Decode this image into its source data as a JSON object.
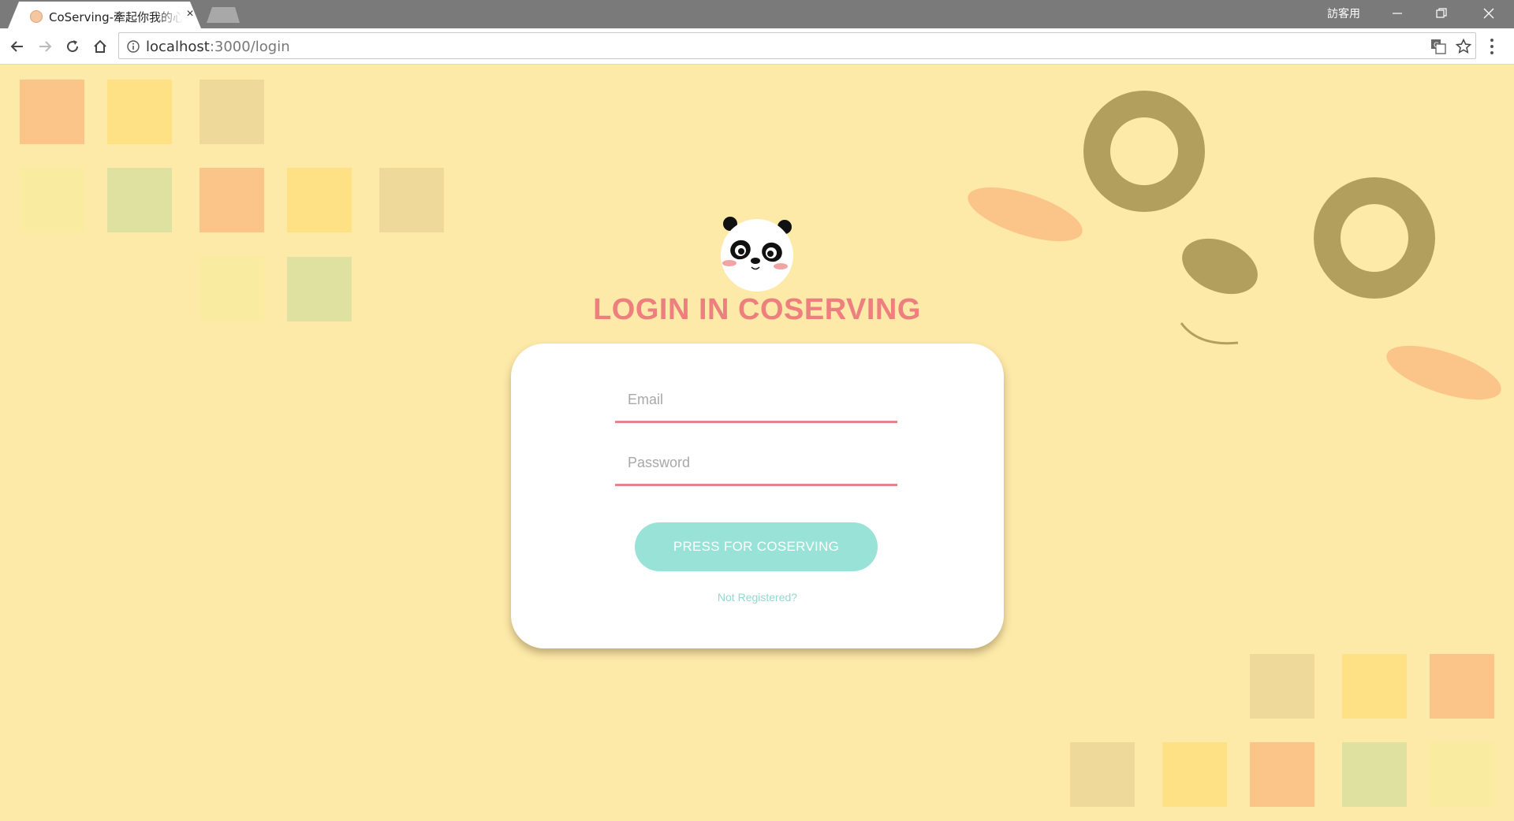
{
  "browser": {
    "tab_title": "CoServing-牽起你我的心",
    "tab_close_glyph": "×",
    "profile_label": "訪客用",
    "url_host": "localhost",
    "url_path": ":3000/login",
    "icons": [
      "favicon-icon",
      "close-icon",
      "new-tab-icon",
      "minimize-icon",
      "maximize-icon",
      "close-window-icon",
      "back-arrow-icon",
      "forward-arrow-icon",
      "reload-icon",
      "home-icon",
      "info-icon",
      "translate-icon",
      "star-icon",
      "menu-icon"
    ]
  },
  "login": {
    "title": "LOGIN IN COSERVING",
    "email_placeholder": "Email",
    "password_placeholder": "Password",
    "submit_label": "PRESS FOR COSERVING",
    "register_link": "Not Registered?"
  },
  "colors": {
    "page_background": "#fde9a8",
    "title": "#ee7f7f",
    "input_underline": "#e58589",
    "button": "#98e2d7",
    "link": "#8fd9cf",
    "ring": "#b29f5e",
    "petal": "#fbc589"
  }
}
